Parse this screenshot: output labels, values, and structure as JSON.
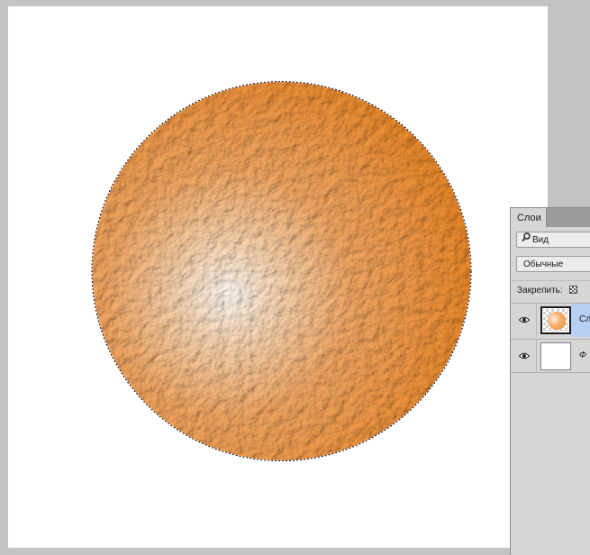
{
  "layers_panel": {
    "tab_label": "Слои",
    "filter_value": "Вид",
    "blend_mode": "Обычные",
    "lock_label": "Закрепить:",
    "layers": [
      {
        "name": "Сл",
        "selected": true,
        "visible": true
      },
      {
        "name": "Ф",
        "selected": false,
        "visible": true
      }
    ]
  },
  "icons": {
    "visibility": "eye-icon",
    "filter": "search-icon",
    "lock_transparency": "checkerboard-lock-icon"
  },
  "colors": {
    "orange": "#ec8a2a",
    "orange_highlight": "#fffaf4",
    "selection_highlight": "#b6cff3",
    "workspace": "#c3c3c3"
  }
}
